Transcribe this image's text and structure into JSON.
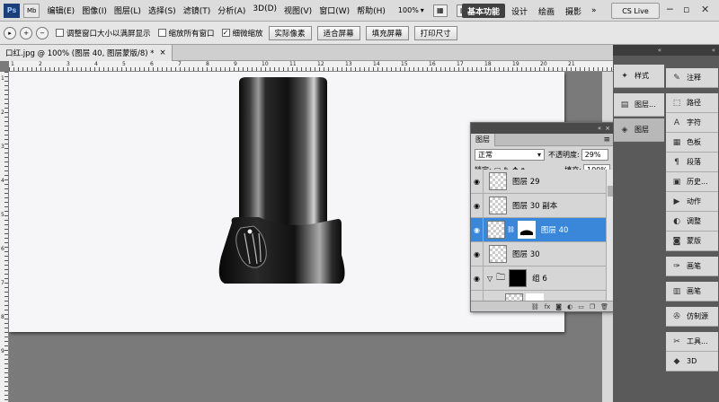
{
  "menubar": {
    "logo": "Ps",
    "app_button": "Mb",
    "items": [
      "编辑(E)",
      "图像(I)",
      "图层(L)",
      "选择(S)",
      "滤镜(T)",
      "分析(A)",
      "3D(D)",
      "视图(V)",
      "窗口(W)",
      "帮助(H)"
    ],
    "zoom": "100%",
    "workspaces": [
      "基本功能",
      "设计",
      "绘画",
      "摄影"
    ],
    "cs_live": "CS Live"
  },
  "options": {
    "checkboxes": [
      {
        "label": "调整窗口大小以满屏显示",
        "checked": false
      },
      {
        "label": "缩放所有窗口",
        "checked": false
      },
      {
        "label": "细微缩放",
        "checked": true
      }
    ],
    "buttons": [
      "实际像素",
      "适合屏幕",
      "填充屏幕",
      "打印尺寸"
    ]
  },
  "document": {
    "tab_title": "口红.jpg @ 100% (图层 40, 图层蒙版/8) *"
  },
  "ruler": {
    "h_labels": [
      "1",
      "2",
      "3",
      "4",
      "5",
      "6",
      "7",
      "8",
      "9",
      "10",
      "11",
      "12",
      "13",
      "14",
      "15",
      "16",
      "17",
      "18",
      "19",
      "20",
      "21"
    ],
    "v_labels": [
      "1",
      "2",
      "3",
      "4",
      "5",
      "6",
      "7",
      "8",
      "9"
    ]
  },
  "layers_panel": {
    "tab": "图层",
    "blend_mode": "正常",
    "opacity_label": "不透明度:",
    "opacity_value": "29%",
    "lock_label": "锁定:",
    "fill_label": "填充:",
    "fill_value": "100%",
    "layers": [
      {
        "name": "图层 29",
        "selected": false,
        "type": "layer"
      },
      {
        "name": "图层 30 副本",
        "selected": false,
        "type": "layer"
      },
      {
        "name": "图层 40",
        "selected": true,
        "type": "masked"
      },
      {
        "name": "图层 30",
        "selected": false,
        "type": "layer"
      },
      {
        "name": "组 6",
        "selected": false,
        "type": "group"
      }
    ],
    "footer_icons": [
      "link-icon",
      "fx-icon",
      "mask-icon",
      "adjustment-icon",
      "folder-icon",
      "new-layer-icon",
      "trash-icon"
    ]
  },
  "dock_a": {
    "items": [
      {
        "label": "样式",
        "icon": "style-icon"
      },
      {
        "label": "图层...",
        "icon": "layers-icon"
      },
      {
        "label": "图层",
        "icon": "layers-stack-icon",
        "active": true
      }
    ]
  },
  "dock_b": {
    "items": [
      {
        "label": "注释",
        "icon": "note-icon"
      },
      {
        "label": "路径",
        "icon": "path-icon"
      },
      {
        "label": "字符",
        "icon": "character-icon"
      },
      {
        "label": "色板",
        "icon": "swatches-icon"
      },
      {
        "label": "段落",
        "icon": "paragraph-icon"
      },
      {
        "label": "历史...",
        "icon": "history-icon"
      },
      {
        "label": "动作",
        "icon": "actions-icon"
      },
      {
        "label": "调整",
        "icon": "adjustments-icon"
      },
      {
        "label": "蒙版",
        "icon": "masks-icon"
      },
      {
        "label": "画笔",
        "icon": "brush-icon"
      },
      {
        "label": "画笔",
        "icon": "brush-presets-icon"
      },
      {
        "label": "仿制源",
        "icon": "clone-source-icon"
      },
      {
        "label": "工具...",
        "icon": "tool-presets-icon"
      },
      {
        "label": "3D",
        "icon": "3d-icon"
      }
    ]
  }
}
